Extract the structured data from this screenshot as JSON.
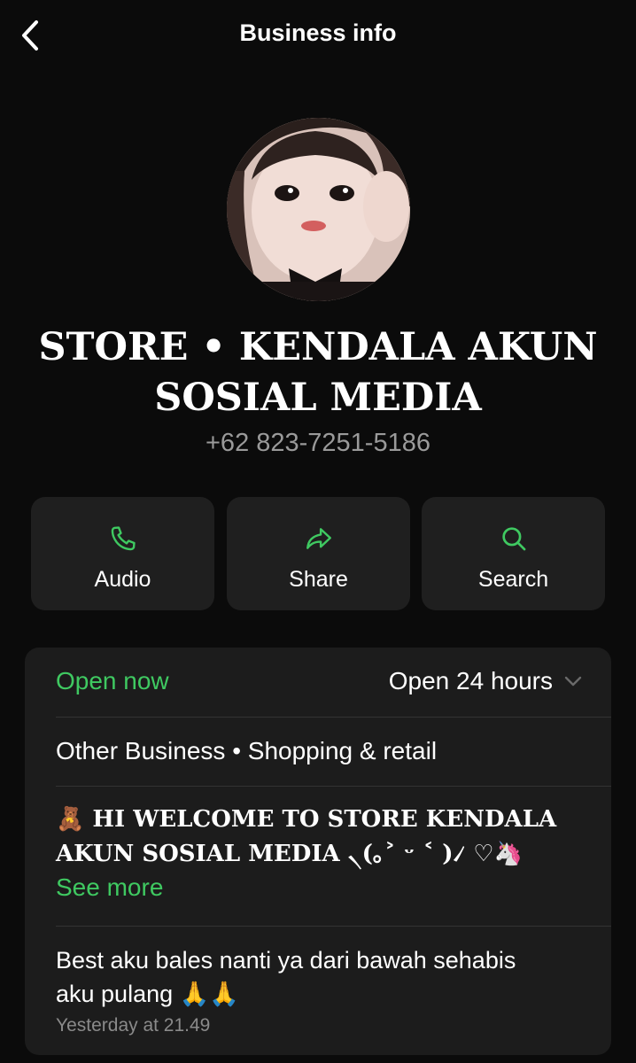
{
  "header": {
    "title": "Business info",
    "back_icon": "chevron-left-icon"
  },
  "profile": {
    "name_line1": "STORE • KENDALA AKUN",
    "name_line2": "SOSIAL MEDIA",
    "phone": "+62 823-7251-5186"
  },
  "actions": [
    {
      "label": "Audio",
      "icon": "phone-icon"
    },
    {
      "label": "Share",
      "icon": "share-arrow-icon"
    },
    {
      "label": "Search",
      "icon": "search-icon"
    }
  ],
  "info": {
    "status": "Open now",
    "hours": "Open 24 hours",
    "category": "Other Business • Shopping & retail",
    "description_line1": "🧸 HI WELCOME TO STORE KENDALA",
    "description_line2": "AKUN SOSIAL MEDIA ৲(｡˃ ᵕ ˂ )৴ ♡🦄",
    "see_more": "See more",
    "message_line1": "Best aku bales nanti ya dari bawah sehabis",
    "message_line2": "aku pulang 🙏🙏",
    "timestamp": "Yesterday at 21.49"
  },
  "colors": {
    "background": "#0b0b0b",
    "card": "#1c1c1c",
    "accent_green": "#3fc961",
    "muted_text": "#9a9a9a"
  }
}
